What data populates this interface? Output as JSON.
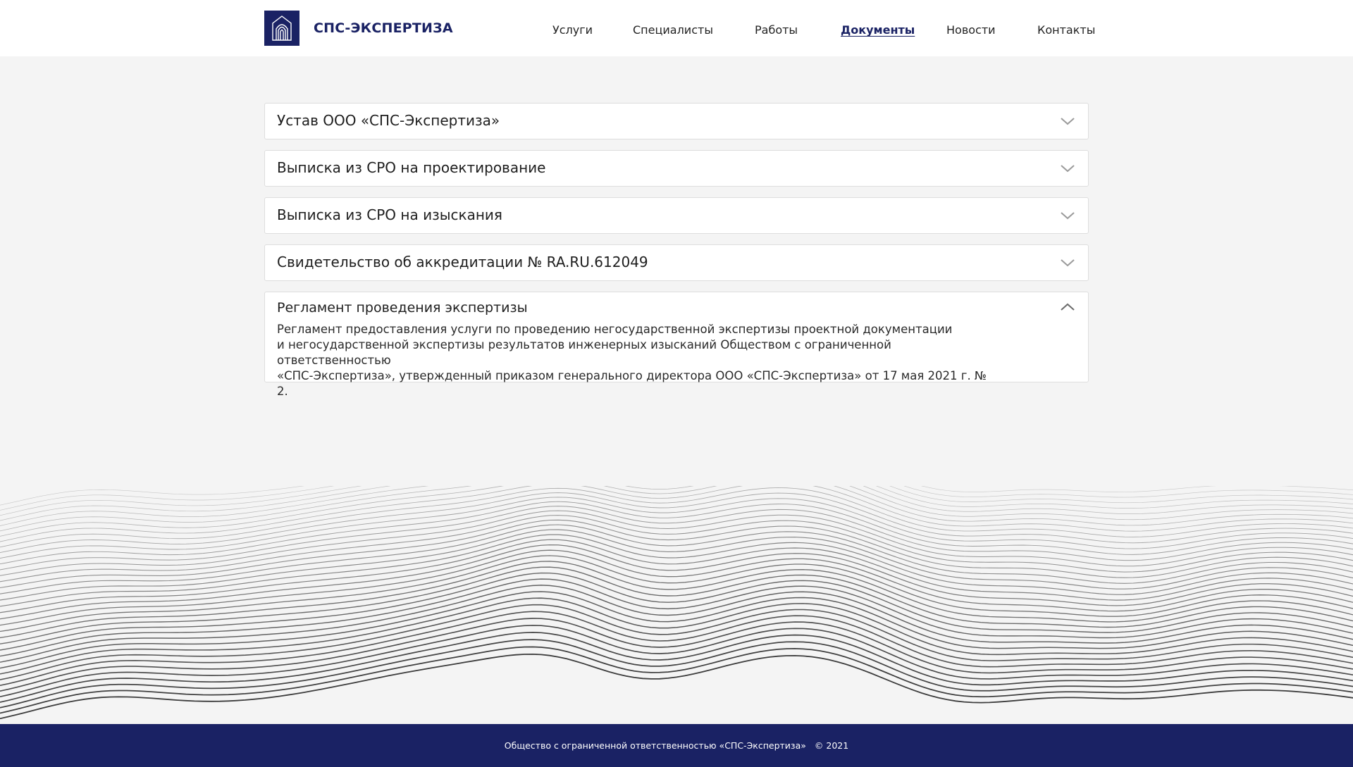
{
  "brand": {
    "name": "СПС-ЭКСПЕРТИЗА",
    "logo_icon": "arch-gate-icon",
    "color": "#1a2264"
  },
  "nav": {
    "items": [
      {
        "label": "Услуги"
      },
      {
        "label": "Специалисты"
      },
      {
        "label": "Работы"
      },
      {
        "label": "Документы",
        "active": true
      },
      {
        "label": "Новости"
      },
      {
        "label": "Контакты"
      }
    ]
  },
  "documents": {
    "items": [
      {
        "title": "Устав ООО «СПС-Экспертиза»",
        "expanded": false
      },
      {
        "title": "Выписка из СРО на проектирование",
        "expanded": false
      },
      {
        "title": "Выписка из СРО на изыскания",
        "expanded": false
      },
      {
        "title": "Свидетельство об аккредитации № RA.RU.612049",
        "expanded": false
      },
      {
        "title": "Регламент проведения экспертизы",
        "expanded": true,
        "body_lines": [
          "Регламент предоставления услуги по проведению негосударственной экспертизы проектной документации",
          "и негосударственной экспертизы результатов инженерных изысканий Обществом с ограниченной ответственностью",
          "«СПС-Экспертиза», утвержденный приказом генерального директора ООО «СПС-Экспертиза» от 17 мая 2021 г. № 2."
        ]
      }
    ]
  },
  "footer": {
    "company": "Общество с ограниченной ответственностью «СПС-Экспертиза»",
    "copyright": "© 2021"
  },
  "colors": {
    "background": "#f4f4f4",
    "footer_bg": "#1a2264",
    "border": "#dddddd"
  }
}
